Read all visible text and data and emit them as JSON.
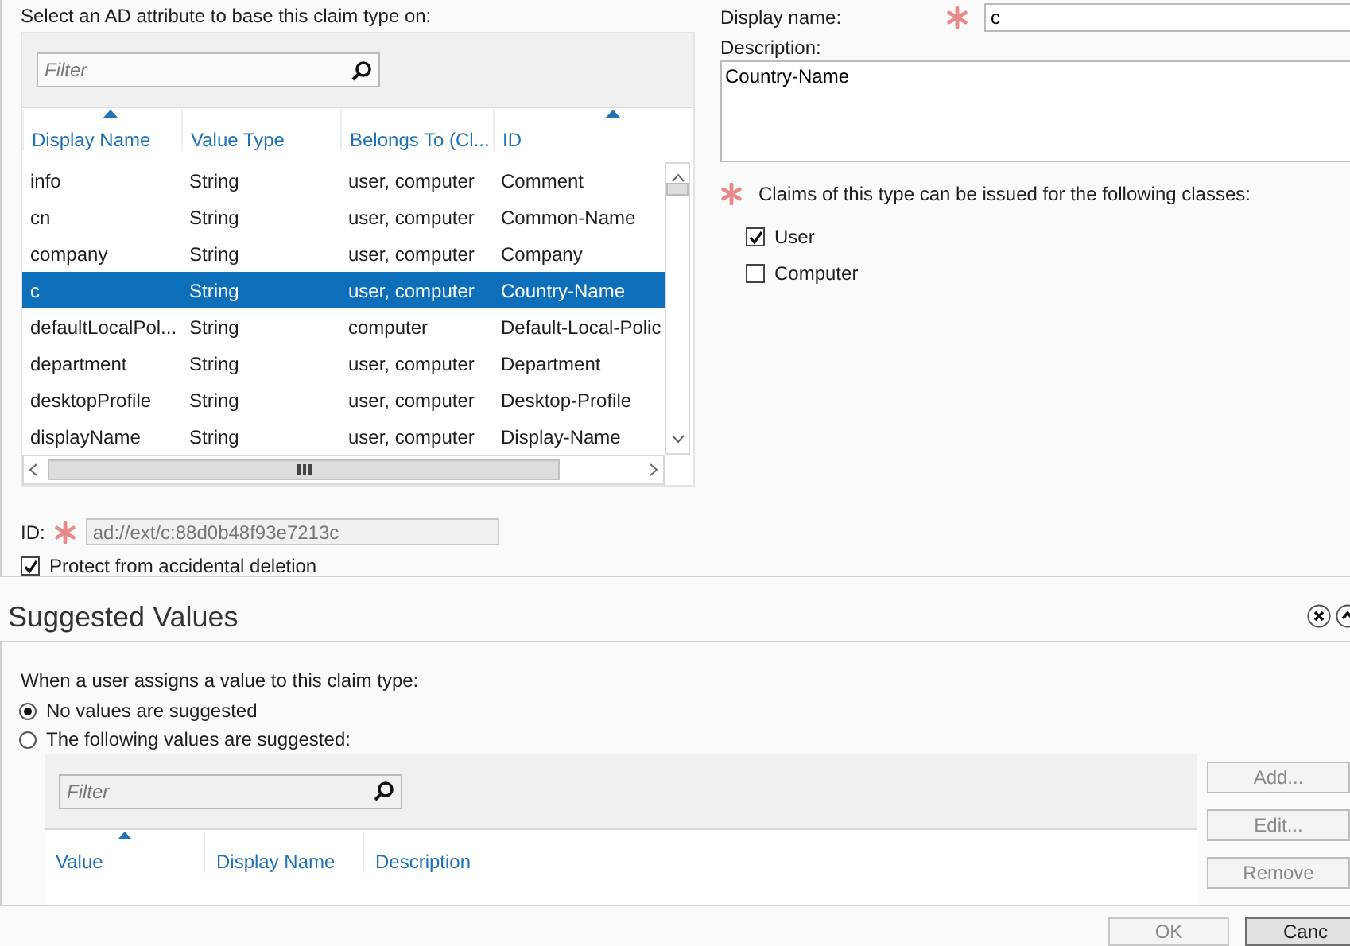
{
  "attribute_picker": {
    "label": "Select an AD attribute to base this claim type on:",
    "filter": {
      "placeholder": "Filter"
    },
    "columns": [
      {
        "label": "Display Name",
        "sorted": true
      },
      {
        "label": "Value Type",
        "sorted": false
      },
      {
        "label": "Belongs To (Cl...",
        "sorted": false
      },
      {
        "label": "ID",
        "sorted": true
      }
    ],
    "rows": [
      {
        "cells": [
          "info",
          "String",
          "user, computer",
          "Comment"
        ],
        "selected": false
      },
      {
        "cells": [
          "cn",
          "String",
          "user, computer",
          "Common-Name"
        ],
        "selected": false
      },
      {
        "cells": [
          "company",
          "String",
          "user, computer",
          "Company"
        ],
        "selected": false
      },
      {
        "cells": [
          "c",
          "String",
          "user, computer",
          "Country-Name"
        ],
        "selected": true
      },
      {
        "cells": [
          "defaultLocalPol...",
          "String",
          "computer",
          "Default-Local-Polic"
        ],
        "selected": false
      },
      {
        "cells": [
          "department",
          "String",
          "user, computer",
          "Department"
        ],
        "selected": false
      },
      {
        "cells": [
          "desktopProfile",
          "String",
          "user, computer",
          "Desktop-Profile"
        ],
        "selected": false
      },
      {
        "cells": [
          "displayName",
          "String",
          "user, computer",
          "Display-Name"
        ],
        "selected": false
      }
    ]
  },
  "id_field": {
    "label": "ID:",
    "value": "ad://ext/c:88d0b48f93e7213c",
    "required": true
  },
  "protect": {
    "label": "Protect from accidental deletion",
    "checked": true
  },
  "display_name": {
    "label": "Display name:",
    "value": "c",
    "required": true
  },
  "description": {
    "label": "Description:",
    "value": "Country-Name"
  },
  "classes": {
    "label": "Claims of this type can be issued for the following classes:",
    "required": true,
    "options": [
      {
        "label": "User",
        "checked": true
      },
      {
        "label": "Computer",
        "checked": false
      }
    ]
  },
  "suggested_values": {
    "title": "Suggested Values",
    "prompt": "When a user assigns a value to this claim type:",
    "options": [
      {
        "label": "No values are suggested",
        "selected": true
      },
      {
        "label": "The following values are suggested:",
        "selected": false
      }
    ],
    "filter": {
      "placeholder": "Filter"
    },
    "columns": [
      {
        "label": "Value",
        "sorted": true
      },
      {
        "label": "Display Name",
        "sorted": false
      },
      {
        "label": "Description",
        "sorted": false
      }
    ],
    "buttons": [
      {
        "label": "Add...",
        "disabled": true
      },
      {
        "label": "Edit...",
        "disabled": true
      },
      {
        "label": "Remove",
        "disabled": true
      }
    ]
  },
  "footer": {
    "buttons": [
      {
        "label": "OK",
        "disabled": true
      },
      {
        "label": "Canc",
        "disabled": false
      }
    ]
  }
}
